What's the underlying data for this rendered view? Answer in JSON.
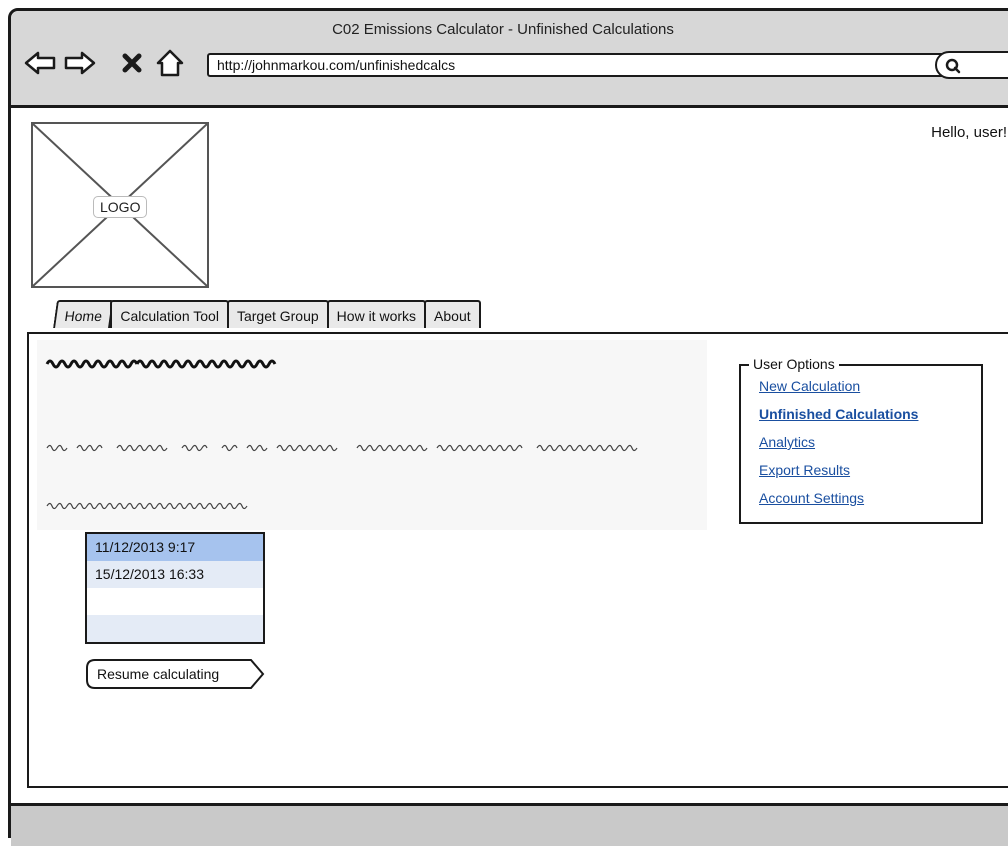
{
  "window": {
    "title": "C02 Emissions Calculator - Unfinished Calculations",
    "url": "http://johnmarkou.com/unfinishedcalcs"
  },
  "nav": {
    "back_icon": "arrow-left-outline",
    "forward_icon": "arrow-right-outline",
    "stop_icon": "x-mark",
    "home_icon": "home-outline",
    "search_icon": "magnifier"
  },
  "header": {
    "logo_text": "LOGO",
    "greeting": "Hello, user!"
  },
  "tabs": [
    {
      "label": "Home"
    },
    {
      "label": "Calculation Tool"
    },
    {
      "label": "Target Group"
    },
    {
      "label": "How it works"
    },
    {
      "label": "About"
    }
  ],
  "user_options": {
    "title": "User Options",
    "items": [
      {
        "label": "New Calculation",
        "active": false
      },
      {
        "label": "Unfinished Calculations",
        "active": true
      },
      {
        "label": "Analytics",
        "active": false
      },
      {
        "label": "Export Results",
        "active": false
      },
      {
        "label": "Account Settings",
        "active": false
      }
    ]
  },
  "calculations": {
    "items": [
      {
        "label": "11/12/2013 9:17",
        "selected": true
      },
      {
        "label": "15/12/2013 16:33",
        "selected": false
      },
      {
        "label": "",
        "selected": false
      },
      {
        "label": "",
        "selected": false
      }
    ]
  },
  "resume_button": {
    "label": "Resume calculating"
  },
  "colors": {
    "link": "#1a4fa0",
    "selected_row": "#a6c3ee",
    "alt_row": "#e4ebf6",
    "chrome": "#d7d7d7"
  }
}
